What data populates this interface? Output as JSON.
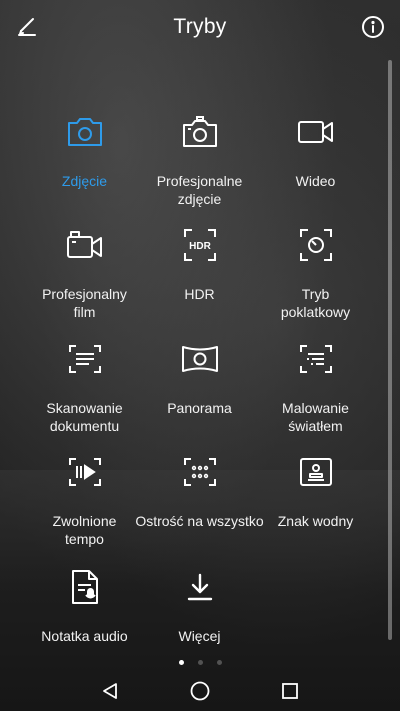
{
  "header": {
    "title": "Tryby",
    "edit_icon": "pencil-icon",
    "info_icon": "info-icon"
  },
  "accent_color": "#2e9bea",
  "modes": [
    {
      "label": "Zdjęcie",
      "icon": "camera-icon",
      "active": true
    },
    {
      "label": "Profesjonalne\nzdjęcie",
      "icon": "pro-camera-icon",
      "active": false
    },
    {
      "label": "Wideo",
      "icon": "video-icon",
      "active": false
    },
    {
      "label": "Profesjonalny\nfilm",
      "icon": "pro-video-icon",
      "active": false
    },
    {
      "label": "HDR",
      "icon": "hdr-icon",
      "active": false
    },
    {
      "label": "Tryb\npoklatkowy",
      "icon": "timelapse-icon",
      "active": false
    },
    {
      "label": "Skanowanie\ndokumentu",
      "icon": "document-scan-icon",
      "active": false
    },
    {
      "label": "Panorama",
      "icon": "panorama-icon",
      "active": false
    },
    {
      "label": "Malowanie\nświatłem",
      "icon": "light-painting-icon",
      "active": false
    },
    {
      "label": "Zwolnione\ntempo",
      "icon": "slow-motion-icon",
      "active": false
    },
    {
      "label": "Ostrość na wszystko",
      "icon": "all-focus-icon",
      "active": false
    },
    {
      "label": "Znak wodny",
      "icon": "watermark-icon",
      "active": false
    },
    {
      "label": "Notatka audio",
      "icon": "audio-note-icon",
      "active": false
    },
    {
      "label": "Więcej",
      "icon": "download-icon",
      "active": false
    }
  ],
  "pager": {
    "pages": 3,
    "current": 1
  },
  "navbar": {
    "back": "back-triangle-icon",
    "home": "home-circle-icon",
    "recents": "recents-square-icon"
  }
}
